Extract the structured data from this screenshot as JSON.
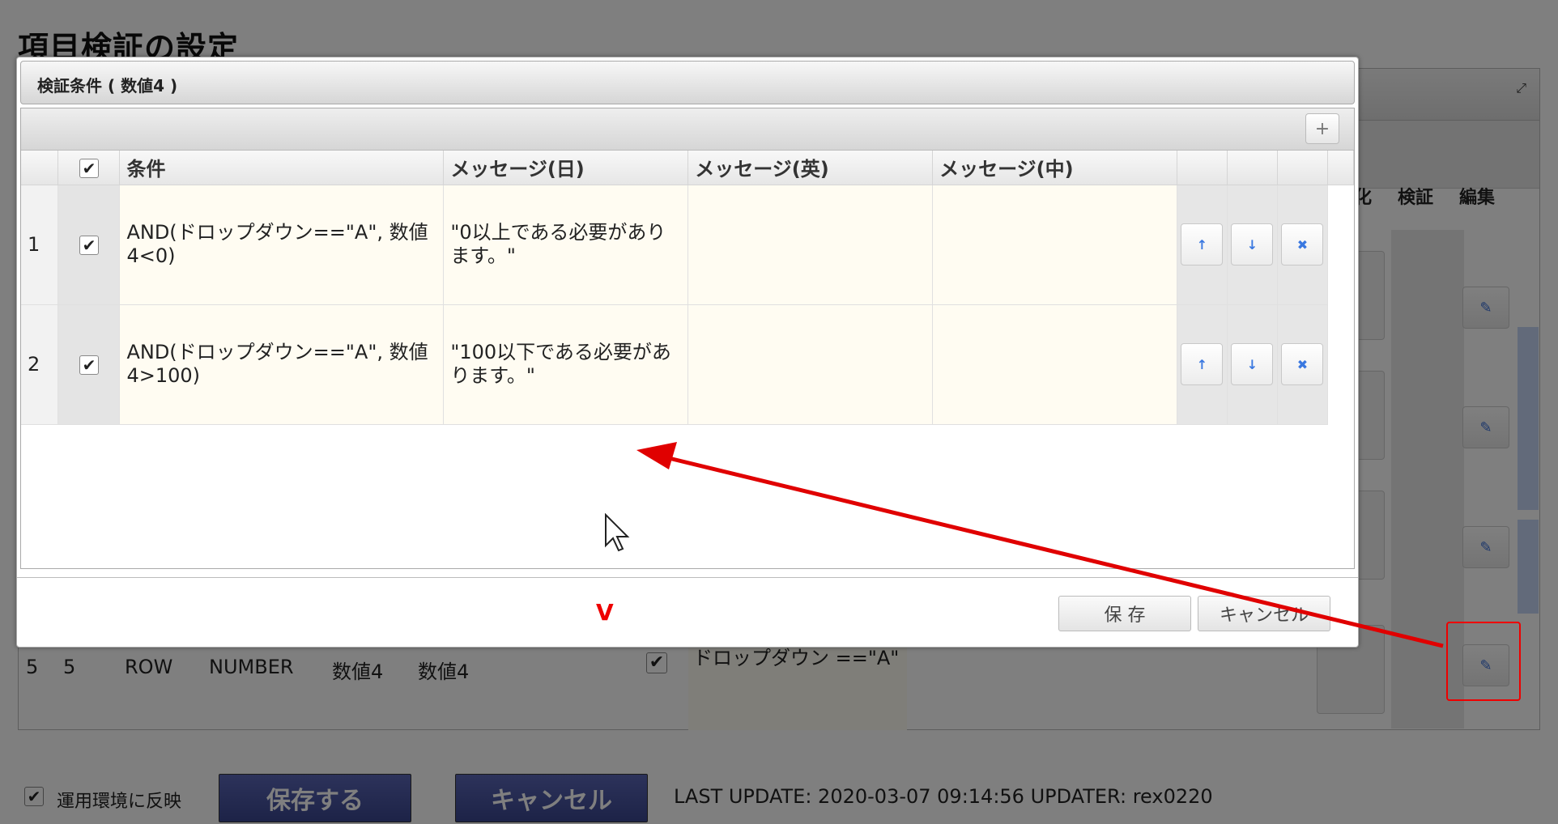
{
  "page": {
    "title": "項目検証の設定"
  },
  "background": {
    "columns": [
      "化",
      "検証",
      "編集"
    ],
    "row5": {
      "no": "5",
      "id": "5",
      "type": "ROW",
      "datatype": "NUMBER",
      "name1": "数値4",
      "name2": "数値4",
      "condition": "ドロップダウン ==\"A\""
    },
    "footer": {
      "reflect_label": "運用環境に反映",
      "save_label": "保存する",
      "cancel_label": "キャンセル",
      "info": "LAST UPDATE: 2020-03-07 09:14:56 UPDATER: rex0220"
    }
  },
  "modal": {
    "title": "検証条件 ( 数値4 )",
    "add_icon": "+",
    "headers": [
      "条件",
      "メッセージ(日)",
      "メッセージ(英)",
      "メッセージ(中)"
    ],
    "rows": [
      {
        "no": "1",
        "checked": true,
        "condition": "AND(ドロップダウン==\"A\", 数値4<0)",
        "msg_ja": "\"0以上である必要があります。\"",
        "msg_en": "",
        "msg_zh": ""
      },
      {
        "no": "2",
        "checked": true,
        "condition": "AND(ドロップダウン==\"A\", 数値4>100)",
        "msg_ja": "\"100以下である必要があります。\"",
        "msg_en": "",
        "msg_zh": ""
      }
    ],
    "action_icons": {
      "up": "arrow-up-icon",
      "down": "arrow-down-icon",
      "delete": "delete-icon"
    },
    "save_label": "保 存",
    "cancel_label": "キャンセル"
  },
  "annotation": {
    "arrow_color": "#e00000",
    "mark": "V"
  }
}
